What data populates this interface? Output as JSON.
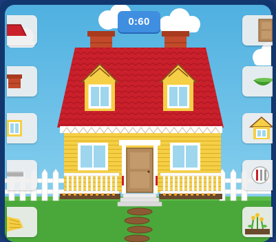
{
  "timer": {
    "label": "0:60"
  },
  "left_toolbar": [
    {
      "icon": "roof-icon"
    },
    {
      "icon": "chimney-icon"
    },
    {
      "icon": "window-icon"
    },
    {
      "icon": "fence-icon"
    },
    {
      "icon": "path-icon"
    }
  ],
  "right_toolbar": [
    {
      "icon": "door-icon"
    },
    {
      "icon": "bush-icon"
    },
    {
      "icon": "dormer-icon"
    },
    {
      "icon": "railing-icon"
    },
    {
      "icon": "flowers-icon"
    }
  ],
  "colors": {
    "sky": "#5cb9e6",
    "grass": "#4aa83a",
    "roof": "#c9202b",
    "walls": "#f5cf45",
    "door": "#b58a5c",
    "timer": "#3f8ee0"
  }
}
